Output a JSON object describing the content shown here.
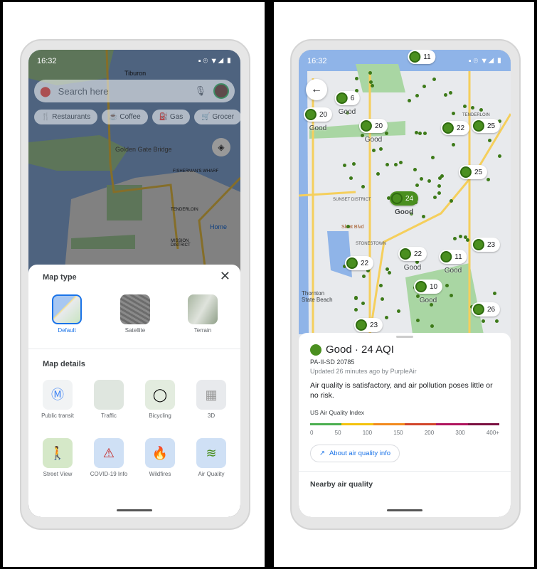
{
  "left": {
    "status_time": "16:32",
    "search_placeholder": "Search here",
    "chips": [
      "Restaurants",
      "Coffee",
      "Gas",
      "Grocer"
    ],
    "map_labels": {
      "tiburon": "Tiburon",
      "ggb": "Golden Gate Bridge",
      "wharf": "FISHERMAN'S WHARF",
      "tenderloin": "TENDERLOIN",
      "home": "Home",
      "mission": "MISSION DISTRICT"
    },
    "sheet": {
      "map_type_title": "Map type",
      "map_types": [
        {
          "label": "Default",
          "selected": true
        },
        {
          "label": "Satellite"
        },
        {
          "label": "Terrain"
        }
      ],
      "map_details_title": "Map details",
      "details": [
        "Public transit",
        "Traffic",
        "Bicycling",
        "3D",
        "Street View",
        "COVID-19 Info",
        "Wildfires",
        "Air Quality"
      ]
    }
  },
  "right": {
    "status_time": "16:32",
    "map_labels": {
      "tenderloin": "TENDERLOIN",
      "sunset": "SUNSET DISTRICT",
      "sloat": "Sloat Blvd",
      "stonestown": "STONESTOWN",
      "thornton": "Thornton State Beach"
    },
    "markers": [
      {
        "aqi": "11"
      },
      {
        "aqi": "6",
        "status": "Good"
      },
      {
        "aqi": "20",
        "status": "Good"
      },
      {
        "aqi": "20",
        "status": "Good"
      },
      {
        "aqi": "22"
      },
      {
        "aqi": "25"
      },
      {
        "aqi": "25"
      },
      {
        "aqi": "24",
        "status": "Good",
        "selected": true
      },
      {
        "aqi": "22",
        "status": "Good"
      },
      {
        "aqi": "22"
      },
      {
        "aqi": "11",
        "status": "Good"
      },
      {
        "aqi": "23"
      },
      {
        "aqi": "10",
        "status": "Good"
      },
      {
        "aqi": "26"
      },
      {
        "aqi": "23"
      }
    ],
    "sheet": {
      "title": "Good · 24 AQI",
      "station": "PA-II-SD 20785",
      "updated": "Updated 26 minutes ago by PurpleAir",
      "description": "Air quality is satisfactory, and air pollution poses little or no risk.",
      "index_title": "US Air Quality Index",
      "scale_ticks": [
        "0",
        "50",
        "100",
        "150",
        "200",
        "300",
        "400+"
      ],
      "scale_colors": [
        "#4caf50",
        "#f4c20d",
        "#f28a1e",
        "#d2452b",
        "#b0155e",
        "#7b1040"
      ],
      "about_link": "About air quality info",
      "nearby_title": "Nearby air quality"
    }
  },
  "colors": {
    "accent": "#1a73e8",
    "good": "#4a8f1f"
  }
}
